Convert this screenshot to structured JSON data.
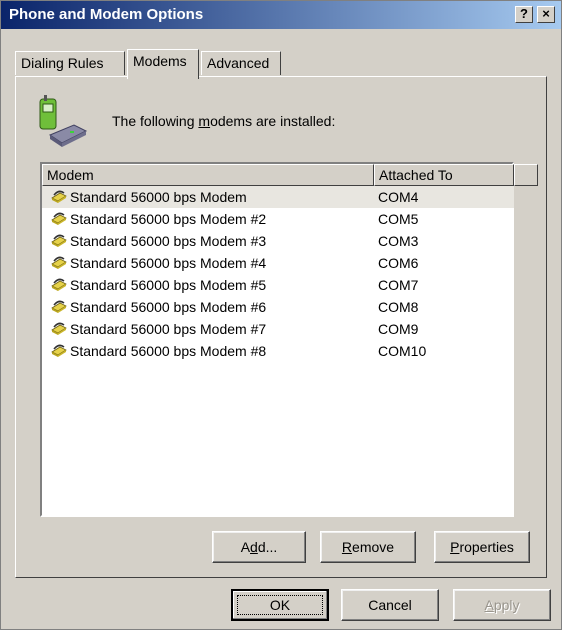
{
  "window": {
    "title": "Phone and Modem Options",
    "help_glyph": "?",
    "close_glyph": "×"
  },
  "tabs": [
    {
      "label": "Dialing Rules",
      "active": false
    },
    {
      "label": "Modems",
      "active": true
    },
    {
      "label": "Advanced",
      "active": false
    }
  ],
  "heading": {
    "before": "The following ",
    "accel": "m",
    "after": "odems are  installed:"
  },
  "list": {
    "columns": [
      "Modem",
      "Attached To"
    ],
    "rows": [
      {
        "name": "Standard 56000 bps Modem",
        "port": "COM4",
        "selected": true
      },
      {
        "name": "Standard 56000 bps Modem #2",
        "port": "COM5"
      },
      {
        "name": "Standard 56000 bps Modem #3",
        "port": "COM3"
      },
      {
        "name": "Standard 56000 bps Modem #4",
        "port": "COM6"
      },
      {
        "name": "Standard 56000 bps Modem #5",
        "port": "COM7"
      },
      {
        "name": "Standard 56000 bps Modem #6",
        "port": "COM8"
      },
      {
        "name": "Standard 56000 bps Modem #7",
        "port": "COM9"
      },
      {
        "name": "Standard 56000 bps Modem #8",
        "port": "COM10"
      }
    ]
  },
  "panel_buttons": {
    "add": {
      "before": "A",
      "accel": "d",
      "after": "d..."
    },
    "remove": {
      "before": "",
      "accel": "R",
      "after": "emove"
    },
    "properties": {
      "before": "",
      "accel": "P",
      "after": "roperties"
    }
  },
  "dialog_buttons": {
    "ok": "OK",
    "cancel": "Cancel",
    "apply": {
      "accel": "A",
      "after": "pply"
    }
  },
  "colors": {
    "title_start": "#0a246a",
    "title_end": "#a6caf0",
    "face": "#d4d0c8"
  }
}
